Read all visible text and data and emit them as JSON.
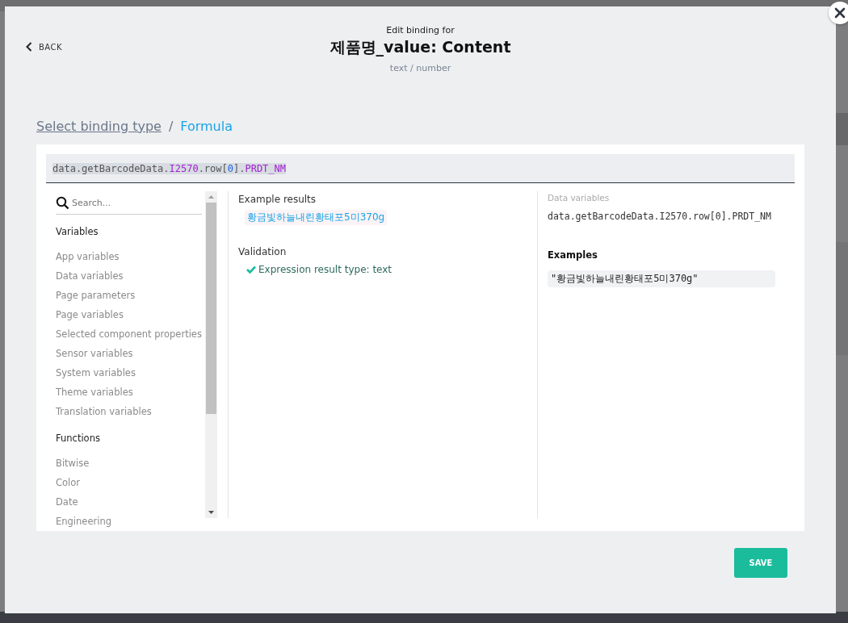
{
  "header": {
    "back": "BACK",
    "subtitle": "Edit binding for",
    "title": "제품명_value: Content",
    "type_hint": "text / number"
  },
  "breadcrumb_separator": "/",
  "breadcrumb": [
    {
      "label": "Select binding type",
      "selected": false
    },
    {
      "label": "Formula",
      "selected": true
    }
  ],
  "expression": [
    {
      "text": "data.getBarcodeData.",
      "kind": "plain"
    },
    {
      "text": "I2570",
      "kind": "key"
    },
    {
      "text": ".row[",
      "kind": "plain"
    },
    {
      "text": "0",
      "kind": "number"
    },
    {
      "text": "].",
      "kind": "plain"
    },
    {
      "text": "PRDT_NM",
      "kind": "key"
    }
  ],
  "sidebar": {
    "search": {
      "placeholder": "Search..."
    },
    "sections": [
      {
        "title": "Variables",
        "items": [
          "App variables",
          "Data variables",
          "Page parameters",
          "Page variables",
          "Selected component properties",
          "Sensor variables",
          "System variables",
          "Theme variables",
          "Translation variables"
        ]
      },
      {
        "title": "Functions",
        "items": [
          "Bitwise",
          "Color",
          "Date",
          "Engineering"
        ]
      }
    ]
  },
  "results": {
    "title": "Example results",
    "value": "황금빛하늘내린황태포5미370g",
    "validation_title": "Validation",
    "validation": {
      "valid": true,
      "message": "Expression result type: text"
    }
  },
  "details": {
    "label": "Data variables",
    "path": "data.getBarcodeData.I2570.row[0].PRDT_NM",
    "examples_title": "Examples",
    "example": "\"황금빛하늘내린황태포5미370g\""
  },
  "save": "SAVE"
}
